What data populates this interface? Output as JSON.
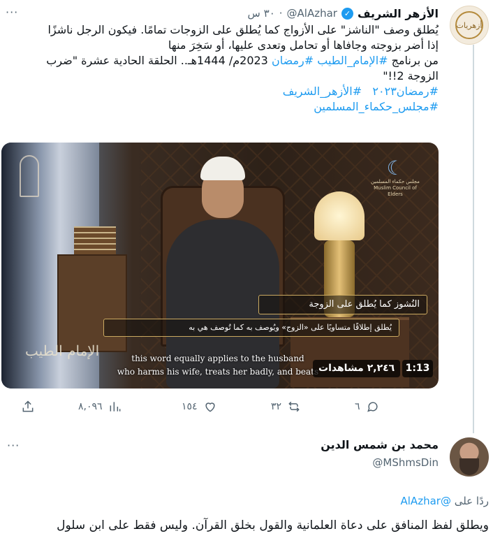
{
  "tweet": {
    "author_name": "الأزهر الشريف",
    "handle": "@AlAzhar",
    "dot": "·",
    "time": "٣٠ س",
    "more": "···",
    "avatar_text": "أزهريات",
    "text_lines": [
      "يُطلق وصف \"الناشز\" على الأزواج كما يُطلق على الزوجات تمامًا. فيكون الرجل ناشزًا",
      "إذا أضر بزوجته وجافاها أو تحامل وتعدى عليها، أو سَخِرَ منها"
    ],
    "line3_before": "من برنامج ",
    "line3_tag1": "#الإمام_الطيب",
    "line3_space": " ",
    "line3_tag2": "#رمضان",
    "line3_after": " 2023م/ 1444هـ.. الحلقة الحادية عشرة \"ضرب",
    "line4": "الزوجة 2!!\"",
    "tags_row1": [
      "#رمضان٢٠٢٣",
      "#الأزهر_الشريف"
    ],
    "tags_row2": "#مجلس_حكماء_المسلمين"
  },
  "video": {
    "caption_title": "النُشوز كما يُطلق على الزوجة",
    "caption_sub": "يُطلق إطلاقًا متساويًا على «الزوج» ويُوصف به كما تُوصف هي به",
    "subtitle_line1": "this word equally applies to the husband",
    "subtitle_line2": "who harms his wife, treats her badly, and beats",
    "views": "٢,٢٤٦ مشاهدات",
    "duration": "1:13",
    "org_name_ar": "مجلس حكماء المسلمين",
    "org_name_en": "Muslim Council of Elders",
    "corner_calligraphy": "الإمام الطيب"
  },
  "actions": {
    "reply_count": "٦",
    "retweet_count": "٣٢",
    "like_count": "١٥٤",
    "view_count": "٨,٠٩٦"
  },
  "reply": {
    "author_name": "محمد بن شمس الدين",
    "handle": "@MShmsDin",
    "more": "···",
    "replying_prefix": "ردًا على",
    "replying_to": "@AlAzhar",
    "text": "ويطلق لفظ المنافق على دعاة العلمانية والقول بخلق القرآن. وليس فقط على ابن سلول"
  },
  "colors": {
    "accent": "#1d9bf0",
    "secondary_text": "#536471",
    "primary_text": "#0f1419"
  }
}
